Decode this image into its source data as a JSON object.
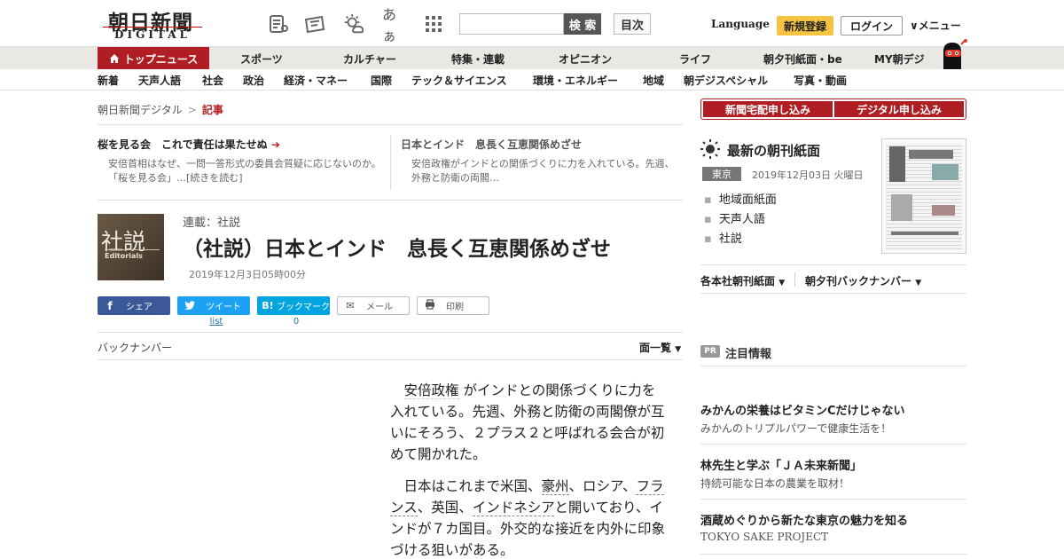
{
  "header": {
    "logo_main": "朝日新聞",
    "logo_sub": "DIGITAL",
    "icon_font": "あぁ",
    "search_placeholder": "",
    "search_label": "検 索",
    "toc_label": "目次",
    "language_label": "Language",
    "register_label": "新規登録",
    "login_label": "ログイン",
    "menu_label": "メニュー"
  },
  "nav_primary": [
    {
      "label": "トップニュース"
    },
    {
      "label": "スポーツ"
    },
    {
      "label": "カルチャー"
    },
    {
      "label": "特集・連載"
    },
    {
      "label": "オピニオン"
    },
    {
      "label": "ライフ"
    },
    {
      "label": "朝夕刊紙面・be"
    },
    {
      "label": "MY朝デジ"
    }
  ],
  "nav_secondary": [
    {
      "label": "新着"
    },
    {
      "label": "天声人語"
    },
    {
      "label": "社会"
    },
    {
      "label": "政治"
    },
    {
      "label": "経済・マネー"
    },
    {
      "label": "国際"
    },
    {
      "label": "テック＆サイエンス"
    },
    {
      "label": "環境・エネルギー"
    },
    {
      "label": "地域"
    },
    {
      "label": "朝デジスペシャル"
    },
    {
      "label": "写真・動画"
    }
  ],
  "breadcrumb": {
    "home": "朝日新聞デジタル",
    "sep": ">",
    "current": "記事"
  },
  "featured": [
    {
      "title": "桜を見る会　これで責任は果たせぬ",
      "desc": "安倍首相はなぜ、一問一答形式の委員会質疑に応じないのか。「桜を見る会」…[続きを読む]"
    },
    {
      "title": "日本とインド　息長く互恵関係めざせ",
      "desc": "安倍政権がインドとの関係づくりに力を入れている。先週、外務と防衛の両閣…"
    }
  ],
  "article": {
    "thumb_big": "社説",
    "thumb_small": "Editorials",
    "series": "連載：社説",
    "headline": "（社説）日本とインド　息長く互恵関係めざせ",
    "date": "2019年12月3日05時00分",
    "share": {
      "facebook": "シェア",
      "twitter": "ツイート",
      "hatena": "ブックマーク",
      "mail": "メール",
      "print": "印刷",
      "twitter_count": "list",
      "hatena_count": "0"
    },
    "backnumber": "バックナンバー",
    "menlist": "面一覧",
    "p1_a": "安倍政権",
    "p1_b": " がインドとの関係づくりに力を入れている。先週、外務と防衛の両閣僚が互いにそろう、２プラス２と呼ばれる会合が初めて開かれた。",
    "p2_a": "日本はこれまで米国、",
    "p2_l1": "豪州",
    "p2_b": "、ロシア、",
    "p2_l2": "フランス",
    "p2_c": "、英国、",
    "p2_l3": "インドネシア",
    "p2_d": "と開いており、インドが７カ国目。外交的な接近を内外に印象づける狙いがある。"
  },
  "sidebar": {
    "sub_delivery": "新聞宅配申し込み",
    "sub_digital": "デジタル申し込み",
    "morning_title": "最新の朝刊紙面",
    "region": "東京",
    "paper_date": "2019年12月03日 火曜日",
    "paper_links": [
      "地域面紙面",
      "天声人語",
      "社説"
    ],
    "link_each": "各本社朝刊紙面",
    "link_back": "朝夕刊バックナンバー",
    "pr_badge": "PR",
    "pr_title": "注目情報",
    "ads": [
      {
        "title": "みかんの栄養はビタミンCだけじゃない",
        "sub": "みかんのトリプルパワーで健康生活を！"
      },
      {
        "title": "林先生と学ぶ「ＪＡ未来新聞」",
        "sub": "持続可能な日本の農業を取材！"
      },
      {
        "title": "酒蔵めぐりから新たな東京の魅力を知る",
        "sub": "TOKYO SAKE PROJECT"
      }
    ]
  },
  "colors": {
    "brand_red": "#b01e23",
    "register_yellow": "#f5c242",
    "facebook": "#3b5998",
    "twitter": "#1da1f2",
    "hatena": "#00a4de"
  }
}
